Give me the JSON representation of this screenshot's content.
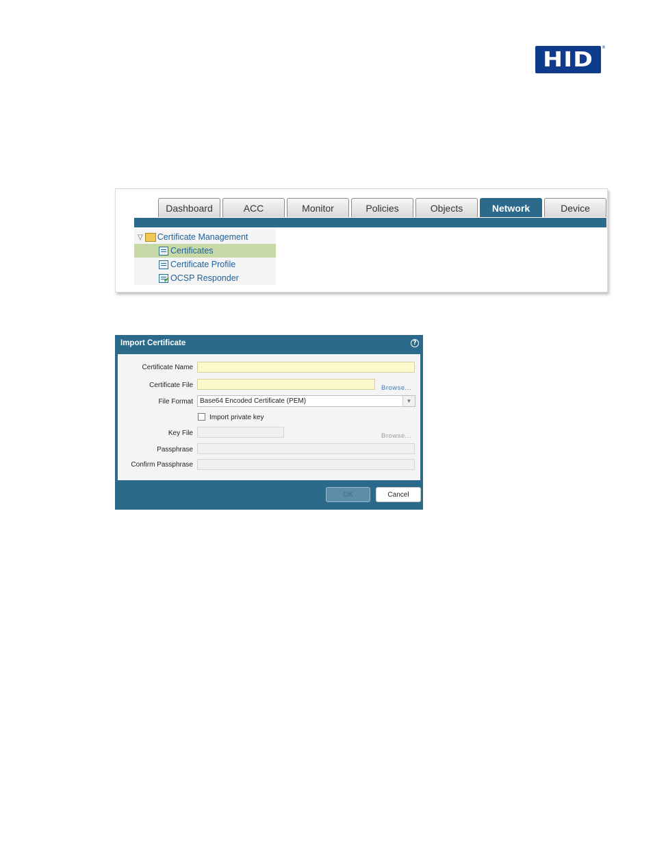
{
  "logo": {
    "text": "HID",
    "reg": "®",
    "color": "#0f3b8c"
  },
  "nav": {
    "tabs": [
      {
        "label": "Dashboard"
      },
      {
        "label": "ACC"
      },
      {
        "label": "Monitor"
      },
      {
        "label": "Policies"
      },
      {
        "label": "Objects"
      },
      {
        "label": "Network",
        "active": true
      },
      {
        "label": "Device"
      }
    ],
    "accent": "#2b6a8a"
  },
  "tree": {
    "parent": "Certificate Management",
    "items": [
      {
        "label": "Certificates",
        "selected": true,
        "icon": "certificate-icon"
      },
      {
        "label": "Certificate Profile",
        "icon": "certificate-profile-icon"
      },
      {
        "label": "OCSP Responder",
        "icon": "ocsp-responder-icon"
      }
    ],
    "selected_color": "#c8d9a8"
  },
  "dialog": {
    "title": "Import Certificate",
    "help": "?",
    "fields": {
      "certificate_name": {
        "label": "Certificate Name",
        "value": ""
      },
      "certificate_file": {
        "label": "Certificate File",
        "value": "",
        "browse": "Browse..."
      },
      "file_format": {
        "label": "File Format",
        "value": "Base64 Encoded Certificate (PEM)"
      },
      "import_private_key": {
        "label": "Import private key",
        "checked": false
      },
      "key_file": {
        "label": "Key File",
        "value": "",
        "browse": "Browse..."
      },
      "passphrase": {
        "label": "Passphrase",
        "value": ""
      },
      "confirm_passphrase": {
        "label": "Confirm Passphrase",
        "value": ""
      }
    },
    "buttons": {
      "ok": "OK",
      "cancel": "Cancel"
    }
  }
}
